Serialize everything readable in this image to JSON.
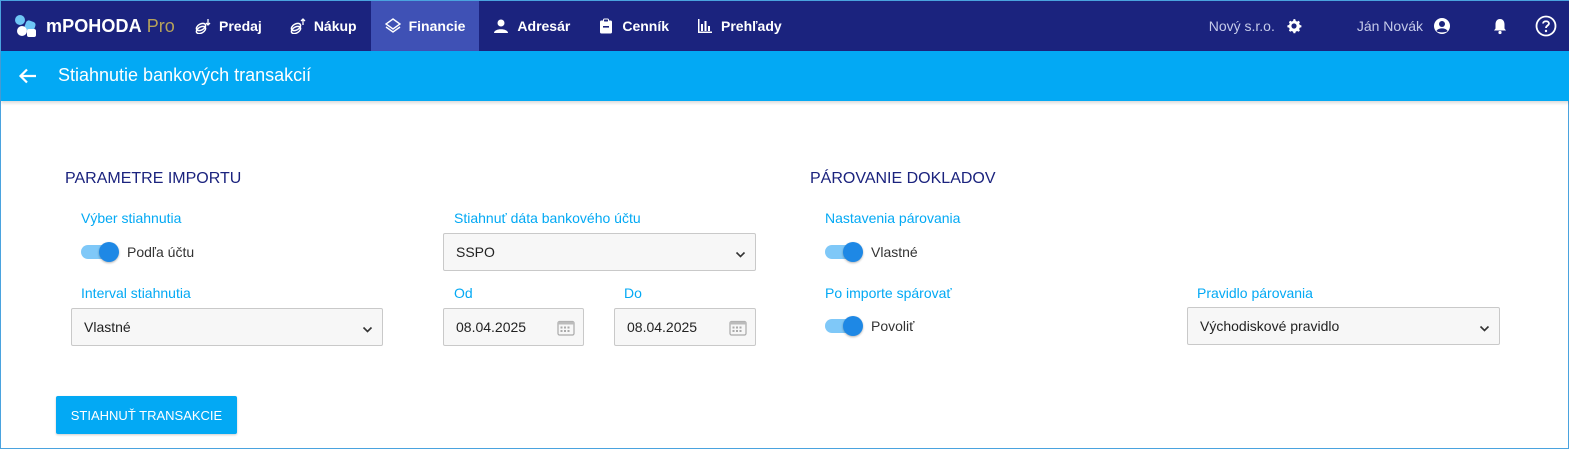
{
  "app": {
    "brand": "mPOHODA",
    "edition": "Pro"
  },
  "nav": [
    {
      "label": "Predaj",
      "icon": "sales-coins-icon"
    },
    {
      "label": "Nákup",
      "icon": "purchase-coins-icon"
    },
    {
      "label": "Financie",
      "icon": "finance-icon",
      "active": true
    },
    {
      "label": "Adresár",
      "icon": "person-icon"
    },
    {
      "label": "Cenník",
      "icon": "clipboard-icon"
    },
    {
      "label": "Prehľady",
      "icon": "bar-chart-icon"
    }
  ],
  "header": {
    "company": "Nový s.r.o.",
    "user": "Ján Novák"
  },
  "page": {
    "title": "Stiahnutie bankových transakcií"
  },
  "import": {
    "section_title": "PARAMETRE IMPORTU",
    "download_choice_label": "Výber stiahnutia",
    "download_choice_value": "Podľa účtu",
    "bank_account_label": "Stiahnuť dáta bankového účtu",
    "bank_account_value": "SSPO",
    "interval_label": "Interval stiahnutia",
    "interval_value": "Vlastné",
    "from_label": "Od",
    "from_value": "08.04.2025",
    "to_label": "Do",
    "to_value": "08.04.2025"
  },
  "pairing": {
    "section_title": "PÁROVANIE DOKLADOV",
    "settings_label": "Nastavenia párovania",
    "settings_value": "Vlastné",
    "after_import_label": "Po importe spárovať",
    "after_import_value": "Povoliť",
    "rule_label": "Pravidlo párovania",
    "rule_value": "Východiskové pravidlo"
  },
  "actions": {
    "download_button": "STIAHNUŤ TRANSAKCIE"
  },
  "colors": {
    "topbar": "#1b237e",
    "active_nav": "#3f51b5",
    "accent": "#03a9f4",
    "toggle": "#1e88e5"
  }
}
